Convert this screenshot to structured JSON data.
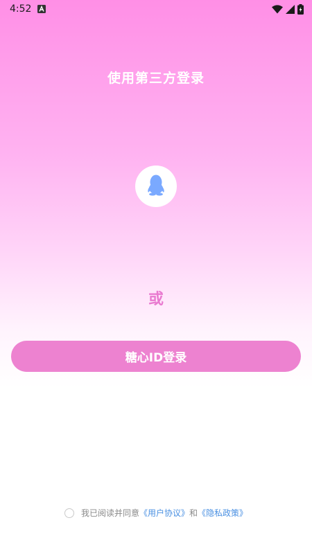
{
  "status_bar": {
    "time": "4:52",
    "app_icon": "a-box-icon",
    "icons": [
      "wifi-icon",
      "signal-icon",
      "battery-icon"
    ]
  },
  "page": {
    "title": "使用第三方登录",
    "third_party_icon": "qq-penguin-icon",
    "or_label": "或",
    "login_button_label": "糖心ID登录"
  },
  "agreement": {
    "prefix": "我已阅读并同意",
    "user_agreement": "《用户协议》",
    "conjunction": "和",
    "privacy_policy": "《隐私政策》"
  },
  "colors": {
    "gradient_top": "#ff8fe6",
    "accent_pink": "#ed82d0",
    "or_pink": "#e97ad0",
    "link_blue": "#4a90e2",
    "qq_blue": "#7aa9ff"
  }
}
